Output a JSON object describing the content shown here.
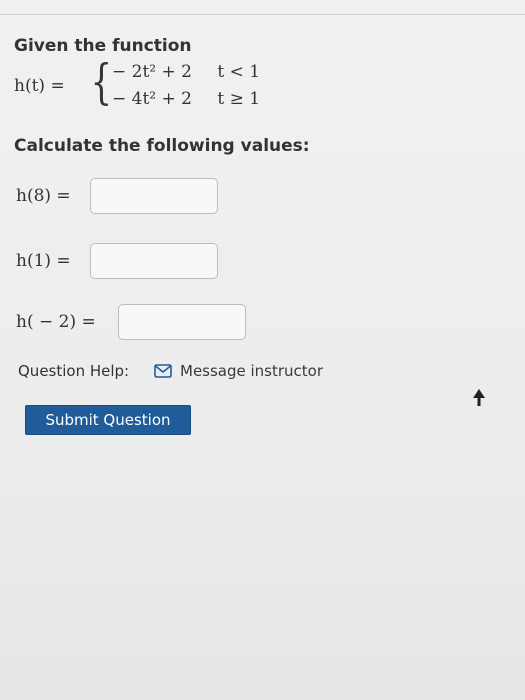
{
  "function_block": {
    "heading": "Given the function",
    "lhs": "h(t) =",
    "cases": [
      {
        "expr": "− 2t² + 2",
        "cond": "t < 1"
      },
      {
        "expr": "− 4t² + 2",
        "cond": "t ≥ 1"
      }
    ]
  },
  "prompt": "Calculate the following values:",
  "questions": [
    {
      "label": "h(8) =",
      "value": ""
    },
    {
      "label": "h(1) =",
      "value": ""
    },
    {
      "label": "h( − 2) =",
      "value": ""
    }
  ],
  "help": {
    "label": "Question Help:",
    "link_text": "Message instructor",
    "icon": "envelope-icon"
  },
  "submit_label": "Submit Question",
  "colors": {
    "button_bg": "#1f5c99",
    "button_text": "#ffffff",
    "link_icon": "#1f5c99"
  }
}
